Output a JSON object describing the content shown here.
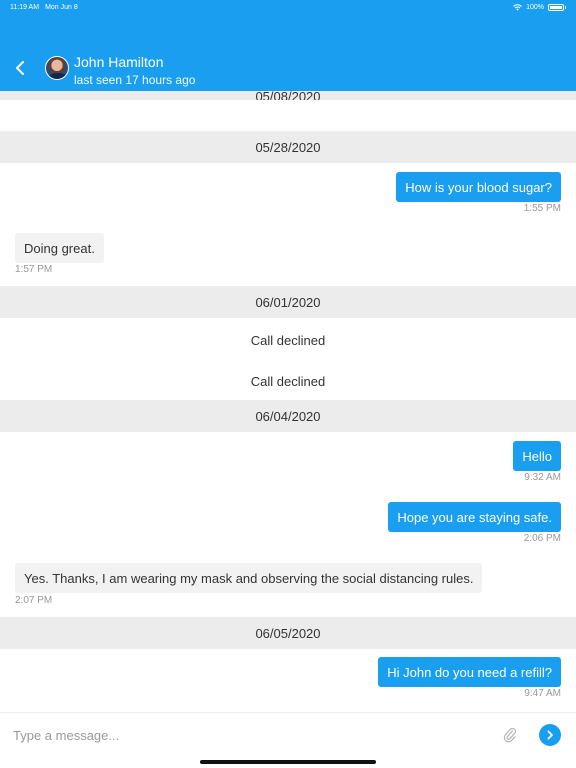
{
  "status_bar": {
    "time": "11:19 AM",
    "date": "Mon Jun 8",
    "battery": "100%"
  },
  "header": {
    "contact_name": "John Hamilton",
    "contact_status": "last seen 17 hours ago",
    "back_icon": "chevron-left-icon",
    "avatar": "contact-avatar-photo"
  },
  "conversation": {
    "partial_date": "05/08/2020",
    "dates": [
      "05/28/2020",
      "06/01/2020",
      "06/04/2020",
      "06/05/2020"
    ],
    "messages": [
      {
        "direction": "out",
        "text": "How is your blood sugar?",
        "time": "1:55 PM"
      },
      {
        "direction": "in",
        "text": "Doing great.",
        "time": "1:57 PM"
      },
      {
        "direction": "out",
        "text": "Hello",
        "time": "9:32 AM"
      },
      {
        "direction": "out",
        "text": "Hope you are staying safe.",
        "time": "2:06 PM"
      },
      {
        "direction": "in",
        "text": "Yes. Thanks, I am wearing my mask and observing the social distancing rules.",
        "time": "2:07 PM"
      },
      {
        "direction": "out",
        "text": "Hi John do you need a refill?",
        "time": "9:47 AM"
      }
    ],
    "events": [
      "Call declined",
      "Call declined"
    ]
  },
  "composer": {
    "placeholder": "Type a message...",
    "attach_icon": "paperclip-icon",
    "send_icon": "send-arrow-icon"
  },
  "colors": {
    "accent": "#1a9ff0",
    "date_bar": "#ececec",
    "incoming_bubble": "#f2f2f2"
  }
}
